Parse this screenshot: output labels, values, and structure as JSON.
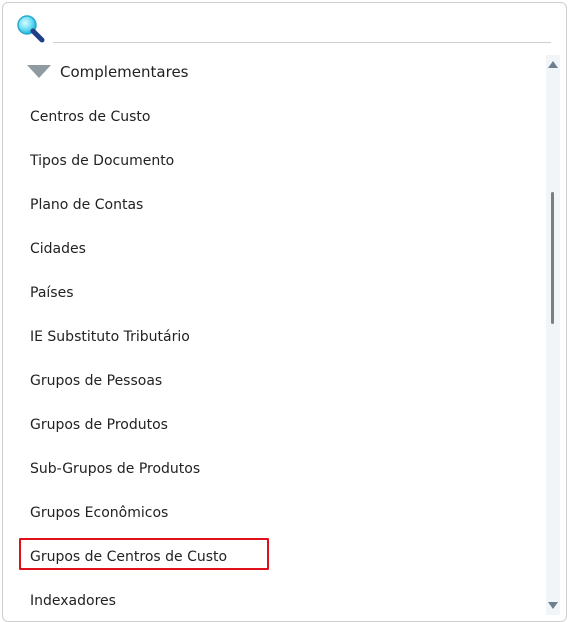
{
  "search": {
    "placeholder": "",
    "value": ""
  },
  "group": {
    "label": "Complementares",
    "expanded": true
  },
  "items": [
    {
      "label": "Centros de Custo"
    },
    {
      "label": "Tipos de Documento"
    },
    {
      "label": "Plano de Contas"
    },
    {
      "label": "Cidades"
    },
    {
      "label": "Países"
    },
    {
      "label": "IE Substituto Tributário"
    },
    {
      "label": "Grupos de Pessoas"
    },
    {
      "label": "Grupos de Produtos"
    },
    {
      "label": "Sub-Grupos de Produtos"
    },
    {
      "label": "Grupos Econômicos"
    },
    {
      "label": "Grupos de Centros de Custo",
      "highlighted": true
    },
    {
      "label": "Indexadores"
    }
  ],
  "colors": {
    "highlight_border": "#e0101a",
    "expand_triangle": "#8f9aa1",
    "search_icon": "#38c4e8"
  },
  "icons": {
    "search": "magnifier-icon",
    "expand": "triangle-down-icon"
  }
}
